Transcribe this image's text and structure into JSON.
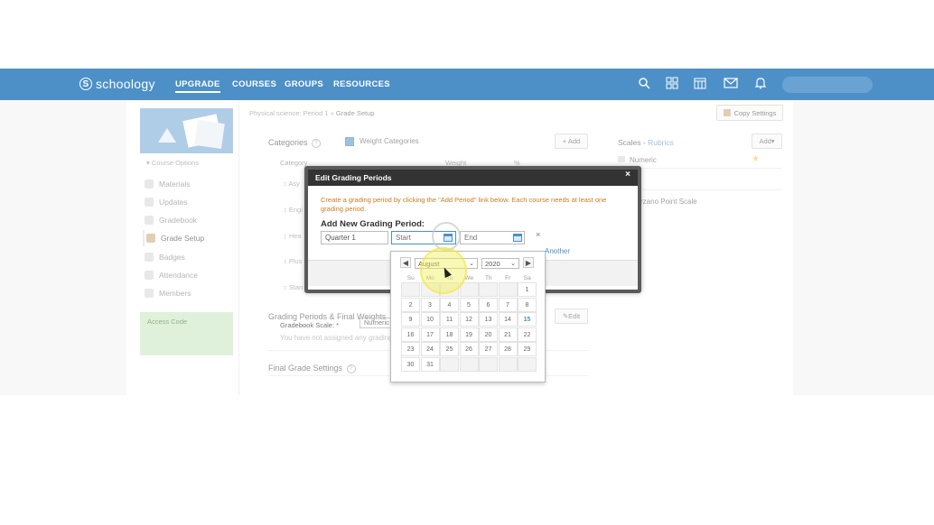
{
  "nav": {
    "logo": "schoology",
    "links": [
      "UPGRADE",
      "COURSES",
      "GROUPS",
      "RESOURCES"
    ],
    "icons": [
      "search-icon",
      "apps-grid-icon",
      "calendar-icon",
      "mail-icon",
      "bell-icon"
    ]
  },
  "sidebar": {
    "course_options": "Course Options",
    "items": [
      "Materials",
      "Updates",
      "Gradebook",
      "Grade Setup",
      "Badges",
      "Attendance",
      "Members"
    ],
    "active": "Grade Setup",
    "access_code": "Access Code"
  },
  "breadcrumb": {
    "course": "Physical science: Period 1",
    "sep": "»",
    "current": "Grade Setup"
  },
  "copy_settings": "Copy Settings",
  "categories": {
    "title": "Categories",
    "help": "?",
    "weight_label": "Weight Categories",
    "add": "+ Add",
    "col_category": "Category",
    "col_weight": "Weight",
    "col_pct": "%",
    "rows": [
      "Asy",
      "Engi",
      "Hea",
      "Plus",
      "Stan"
    ]
  },
  "grading_periods": {
    "title": "Grading Periods & Final Weights",
    "edit": "Edit",
    "empty": "You have not assigned any grading"
  },
  "final_grade": {
    "title": "Final Grade Settings",
    "help": "?",
    "gradebook_scale_label": "Gradebook Scale: *",
    "gradebook_scale_value": "Numeric"
  },
  "scales": {
    "title": "Scales",
    "sep": " - ",
    "rubrics": "Rubrics",
    "add": "Add",
    "items": [
      "Numeric",
      "rzano Point Scale"
    ]
  },
  "modal": {
    "title": "Edit Grading Periods",
    "close": "×",
    "message": "Create a grading period by clicking the \"Add Period\" link below. Each course needs at least one grading period.",
    "add_label": "Add New Grading Period:",
    "name_value": "Quarter 1",
    "start_placeholder": "Start",
    "end_placeholder": "End",
    "remove": "×",
    "another": "Another"
  },
  "datepicker": {
    "prev": "◀",
    "next": "▶",
    "month": "August",
    "year": "2020",
    "dow": [
      "Su",
      "Mo",
      "Tu",
      "We",
      "Th",
      "Fr",
      "Sa"
    ],
    "weeks": [
      [
        "",
        "",
        "",
        "",
        "",
        "",
        "1"
      ],
      [
        "2",
        "3",
        "4",
        "5",
        "6",
        "7",
        "8"
      ],
      [
        "9",
        "10",
        "11",
        "12",
        "13",
        "14",
        "15"
      ],
      [
        "16",
        "17",
        "18",
        "19",
        "20",
        "21",
        "22"
      ],
      [
        "23",
        "24",
        "25",
        "26",
        "27",
        "28",
        "29"
      ],
      [
        "30",
        "31",
        "",
        "",
        "",
        "",
        ""
      ]
    ],
    "highlight": "15"
  }
}
